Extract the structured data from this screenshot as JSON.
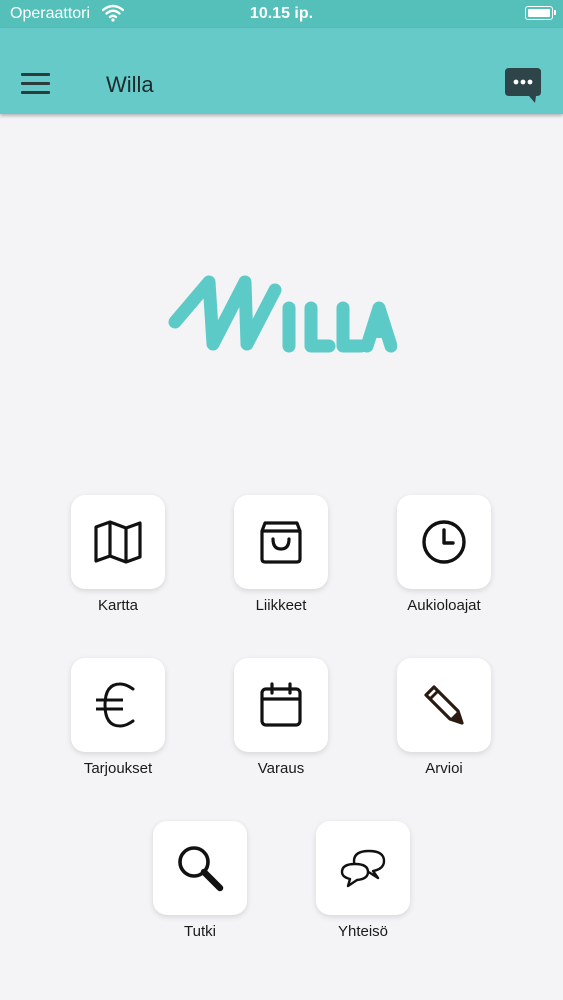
{
  "status_bar": {
    "carrier": "Operaattori",
    "time": "10.15 ip."
  },
  "app_bar": {
    "title": "Willa",
    "menu_icon": "hamburger-icon",
    "chat_icon": "chat-bubble-icon"
  },
  "logo": {
    "text": "WILLA",
    "color": "#5ccbc7"
  },
  "colors": {
    "app_bar": "#66cbc8",
    "status_bar": "#55bfba",
    "background": "#f4f3f6",
    "tile": "#ffffff"
  },
  "menu": {
    "items": [
      {
        "label": "Kartta",
        "icon": "map-icon"
      },
      {
        "label": "Liikkeet",
        "icon": "shopping-bag-icon"
      },
      {
        "label": "Aukioloajat",
        "icon": "clock-icon"
      },
      {
        "label": "Tarjoukset",
        "icon": "euro-icon"
      },
      {
        "label": "Varaus",
        "icon": "calendar-icon"
      },
      {
        "label": "Arvioi",
        "icon": "pencil-icon"
      },
      {
        "label": "Tutki",
        "icon": "search-icon"
      },
      {
        "label": "Yhteisö",
        "icon": "speech-bubbles-icon"
      }
    ]
  }
}
